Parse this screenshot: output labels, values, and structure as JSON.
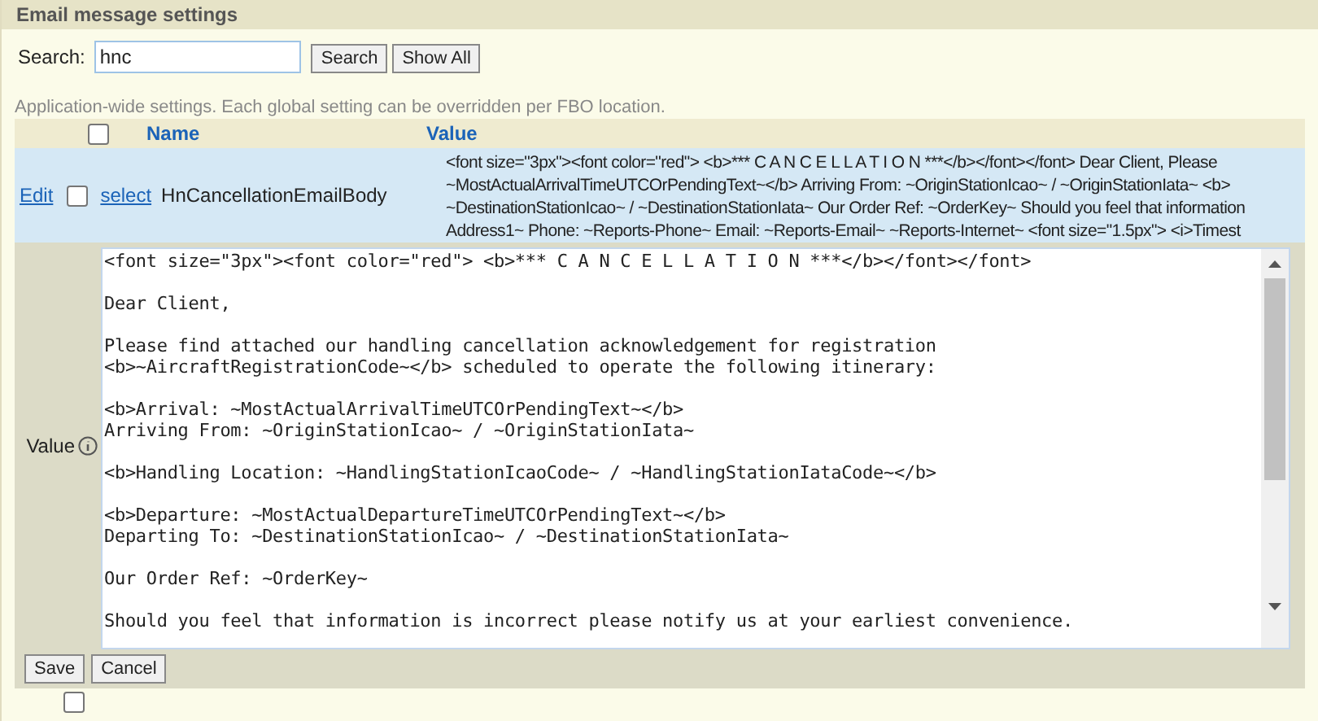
{
  "panel": {
    "title": "Email message settings"
  },
  "search": {
    "label": "Search:",
    "value": "hnc",
    "buttons": [
      "Search",
      "Show All"
    ]
  },
  "note": "Application-wide settings. Each global setting can be overridden per FBO location.",
  "table": {
    "select_all_checked": false,
    "columns": [
      "Name",
      "Value"
    ],
    "rows": [
      {
        "edit_link": "Edit",
        "checked": false,
        "select_link": "select",
        "name": "HnCancellationEmailBody",
        "selected": true,
        "value_lines": [
          "<font size=\"3px\"><font color=\"red\"> <b>*** C A N C E L L A T I O N ***</b></font></font> Dear Client, Please",
          "~MostActualArrivalTimeUTCOrPendingText~</b> Arriving From: ~OriginStationIcao~ / ~OriginStationIata~ <b>",
          "~DestinationStationIcao~ / ~DestinationStationIata~ Our Order Ref: ~OrderKey~ Should you feel that information",
          "Address1~ Phone: ~Reports-Phone~ Email: ~Reports-Email~ ~Reports-Internet~ <font size=\"1.5px\"> <i>Timest"
        ]
      }
    ]
  },
  "editor": {
    "label": "Value",
    "paragraphs": [
      [
        "<font size=\"3px\"><font color=\"red\"> <b>*** C A N C E L L A T I O N ***</b></font></font>"
      ],
      [
        "Dear Client,"
      ],
      [
        "Please find attached our handling cancellation acknowledgement for registration",
        "<b>~AircraftRegistrationCode~</b> scheduled to operate the following itinerary:"
      ],
      [
        "<b>Arrival: ~MostActualArrivalTimeUTCOrPendingText~</b>",
        "Arriving From: ~OriginStationIcao~ / ~OriginStationIata~"
      ],
      [
        "<b>Handling Location: ~HandlingStationIcaoCode~ / ~HandlingStationIataCode~</b>"
      ],
      [
        "<b>Departure: ~MostActualDepartureTimeUTCOrPendingText~</b>",
        "Departing To: ~DestinationStationIcao~ / ~DestinationStationIata~"
      ],
      [
        "Our Order Ref: ~OrderKey~"
      ],
      [
        "Should you feel that information is incorrect please notify us at your earliest convenience."
      ]
    ],
    "buttons": [
      "Save",
      "Cancel"
    ]
  },
  "next_row": {
    "checked": false
  }
}
